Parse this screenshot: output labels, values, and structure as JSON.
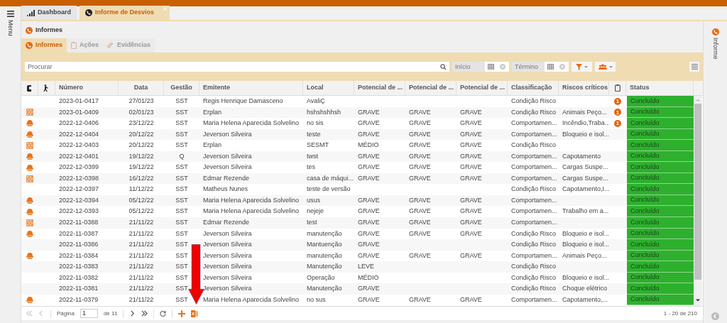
{
  "side_menu": {
    "label": "Menu"
  },
  "top_tabs": [
    {
      "label": "Dashboard",
      "selected": false,
      "closable": false
    },
    {
      "label": "Informe de Desvios",
      "selected": true,
      "closable": true
    }
  ],
  "panel_title": "Informes",
  "sub_tabs": [
    {
      "label": "Informes",
      "selected": true,
      "disabled": false
    },
    {
      "label": "Ações",
      "selected": false,
      "disabled": true
    },
    {
      "label": "Evidências",
      "selected": false,
      "disabled": true
    }
  ],
  "toolbar": {
    "search": {
      "placeholder": "Procurar"
    },
    "start_date": {
      "placeholder": "Início"
    },
    "end_date": {
      "placeholder": "Término"
    }
  },
  "table": {
    "columns": [
      {
        "kind": "glove"
      },
      {
        "kind": "figure"
      },
      {
        "kind": "text",
        "label": "Número"
      },
      {
        "kind": "text",
        "label": "Data"
      },
      {
        "kind": "text",
        "label": "Gestão"
      },
      {
        "kind": "text",
        "label": "Emitente"
      },
      {
        "kind": "text",
        "label": "Local"
      },
      {
        "kind": "text",
        "label": "Potencial de ..."
      },
      {
        "kind": "text",
        "label": "Potencial de ..."
      },
      {
        "kind": "text",
        "label": "Potencial de ..."
      },
      {
        "kind": "text",
        "label": "Classificação"
      },
      {
        "kind": "text",
        "label": "Riscos críticos"
      },
      {
        "kind": "clipboard"
      },
      {
        "kind": "status",
        "label": "Status"
      }
    ],
    "rows": [
      {
        "numero": "2023-01-0417",
        "data": "27/01/23",
        "gestao": "SST",
        "emitente": "Regis Henrique Damasceno",
        "local": "AvaliÇ",
        "classificacao": "Condição Risco",
        "badge": "1",
        "status": "Concluído"
      },
      {
        "kind": "pattern",
        "numero": "2023-01-0409",
        "data": "02/01/23",
        "gestao": "SST",
        "emitente": "Erplan",
        "local": "hshshshhsh",
        "potencial_1": "GRAVE",
        "potencial_2": "GRAVE",
        "potencial_3": "GRAVE",
        "classificacao": "Condição Risco",
        "riscos_criticos": "Animais Peço...",
        "badge": "1",
        "status": "Concluído"
      },
      {
        "kind": "helmet",
        "numero": "2022-12-0406",
        "data": "23/12/22",
        "gestao": "SST",
        "emitente": "Maria Helena Aparecida Solvelino",
        "local": "no sis",
        "potencial_1": "GRAVE",
        "potencial_2": "GRAVE",
        "potencial_3": "GRAVE",
        "classificacao": "Comportamen...",
        "riscos_criticos": "Incêndio,Traba...",
        "badge": "1",
        "status": "Concluído"
      },
      {
        "kind": "helmet",
        "numero": "2022-12-0404",
        "data": "20/12/22",
        "gestao": "SST",
        "emitente": "Jeverson Silveira",
        "local": "teste",
        "potencial_1": "GRAVE",
        "potencial_2": "GRAVE",
        "potencial_3": "GRAVE",
        "classificacao": "Comportamen...",
        "riscos_criticos": "Bloqueio e isol...",
        "status": "Concluído"
      },
      {
        "kind": "pattern",
        "numero": "2022-12-0403",
        "data": "20/12/22",
        "gestao": "SST",
        "emitente": "Erplan",
        "local": "SESMT",
        "potencial_1": "MÉDIO",
        "potencial_2": "GRAVE",
        "potencial_3": "GRAVE",
        "classificacao": "Condição Risco",
        "status": "Concluído"
      },
      {
        "kind": "helmet",
        "numero": "2022-12-0401",
        "data": "19/12/22",
        "gestao": "Q",
        "emitente": "Jeverson Silveira",
        "local": "twst",
        "potencial_1": "GRAVE",
        "potencial_2": "GRAVE",
        "potencial_3": "GRAVE",
        "classificacao": "Comportamen...",
        "riscos_criticos": "Capotamento",
        "status": "Concluído"
      },
      {
        "kind": "helmet",
        "numero": "2022-12-0399",
        "data": "19/12/22",
        "gestao": "SST",
        "emitente": "Jeverson Silveira",
        "local": "tes",
        "potencial_1": "GRAVE",
        "potencial_2": "GRAVE",
        "potencial_3": "GRAVE",
        "classificacao": "Comportamen...",
        "riscos_criticos": "Cargas Suspe...",
        "status": "Concluído"
      },
      {
        "kind": "pattern",
        "numero": "2022-12-0398",
        "data": "16/12/22",
        "gestao": "SST",
        "emitente": "Edmar Rezende",
        "local": "casa de máqui...",
        "potencial_1": "GRAVE",
        "potencial_2": "GRAVE",
        "potencial_3": "GRAVE",
        "classificacao": "Comportamen...",
        "riscos_criticos": "Cargas Suspe...",
        "status": "Concluído"
      },
      {
        "numero": "2022-12-0397",
        "data": "11/12/22",
        "gestao": "SST",
        "emitente": "Matheus Nunes",
        "local": "teste de versão",
        "classificacao": "Condição Risco",
        "riscos_criticos": "Capotamento,I...",
        "status": "Concluído"
      },
      {
        "kind": "helmet",
        "numero": "2022-12-0394",
        "data": "05/12/22",
        "gestao": "SST",
        "emitente": "Maria Helena Aparecida Solvelino",
        "local": "usus",
        "potencial_1": "GRAVE",
        "potencial_2": "GRAVE",
        "potencial_3": "GRAVE",
        "classificacao": "Comportamen...",
        "status": "Concluído"
      },
      {
        "kind": "helmet",
        "numero": "2022-12-0393",
        "data": "05/12/22",
        "gestao": "SST",
        "emitente": "Maria Helena Aparecida Solvelino",
        "local": "nejeje",
        "potencial_1": "GRAVE",
        "potencial_2": "GRAVE",
        "potencial_3": "GRAVE",
        "classificacao": "Comportamen...",
        "riscos_criticos": "Trabalho em a...",
        "status": "Concluído"
      },
      {
        "kind": "pattern",
        "numero": "2022-11-0388",
        "data": "21/11/22",
        "gestao": "SST",
        "emitente": "Edmar Rezende",
        "local": "test",
        "potencial_1": "GRAVE",
        "potencial_2": "GRAVE",
        "potencial_3": "GRAVE",
        "classificacao": "Comportamen...",
        "status": "Concluído"
      },
      {
        "kind": "helmet",
        "numero": "2022-11-0387",
        "data": "21/11/22",
        "gestao": "SST",
        "emitente": "Jeverson Silveira",
        "local": "manutenção",
        "potencial_1": "GRAVE",
        "potencial_2": "GRAVE",
        "potencial_3": "GRAVE",
        "classificacao": "Condição Risco",
        "riscos_criticos": "Bloqueio e isol...",
        "status": "Concluído"
      },
      {
        "numero": "2022-11-0386",
        "data": "21/11/22",
        "gestao": "SST",
        "emitente": "Jeverson Silveira",
        "local": "Mantuenção",
        "potencial_1": "GRAVE",
        "classificacao": "Condição Risco",
        "riscos_criticos": "Bloqueio e isol...",
        "status": "Concluído"
      },
      {
        "kind": "helmet",
        "numero": "2022-11-0384",
        "data": "21/11/22",
        "gestao": "SST",
        "emitente": "Jeverson Silveira",
        "local": "manutenção",
        "potencial_1": "GRAVE",
        "potencial_2": "GRAVE",
        "potencial_3": "GRAVE",
        "classificacao": "Comportamen...",
        "riscos_criticos": "Animais Peço...",
        "status": "Concluído"
      },
      {
        "numero": "2022-11-0383",
        "data": "21/11/22",
        "gestao": "SST",
        "emitente": "Jeverson Silveira",
        "local": "Manutenção",
        "potencial_1": "LEVE",
        "classificacao": "Condição Risco",
        "status": "Concluído"
      },
      {
        "numero": "2022-11-0382",
        "data": "21/11/22",
        "gestao": "SST",
        "emitente": "Jeverson Silveira",
        "local": "Operação",
        "potencial_1": "MÉDIO",
        "classificacao": "Condição Risco",
        "riscos_criticos": "Bloqueio e isol...",
        "status": "Concluído"
      },
      {
        "numero": "2022-11-0381",
        "data": "21/11/22",
        "gestao": "SST",
        "emitente": "Jeverson Silveira",
        "local": "Manutenção",
        "potencial_1": "GRAVE",
        "classificacao": "Condição Risco",
        "riscos_criticos": "Choque elétrico",
        "status": "Concluído"
      },
      {
        "kind": "helmet",
        "numero": "2022-11-0379",
        "data": "21/11/22",
        "gestao": "SST",
        "emitente": "Maria Helena Aparecida Solvelino",
        "local": "no sus",
        "potencial_1": "GRAVE",
        "potencial_2": "GRAVE",
        "potencial_3": "GRAVE",
        "classificacao": "Comportamen...",
        "riscos_criticos": "Capotamento,...",
        "status": "Concluído"
      }
    ]
  },
  "pager": {
    "page_label": "Página",
    "page": "1",
    "of_label": "de 11",
    "range": "1 - 20 de 210"
  },
  "right_panel": {
    "label": "Informe"
  },
  "annotation": {
    "kind": "arrow"
  }
}
